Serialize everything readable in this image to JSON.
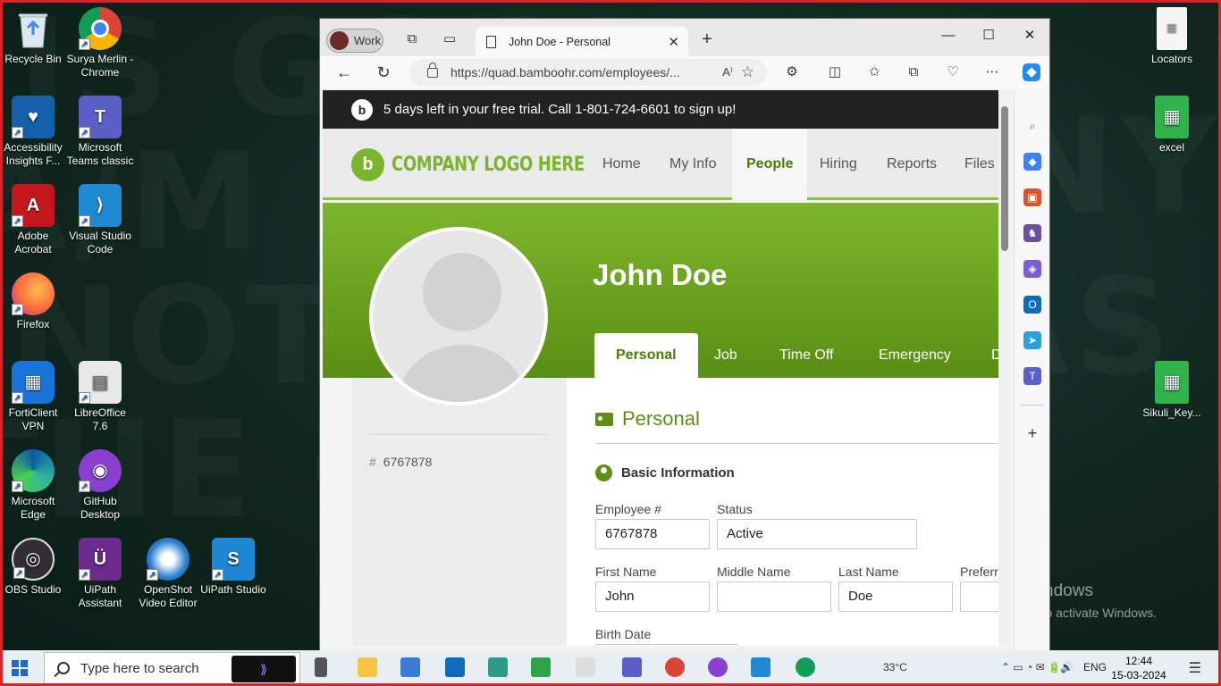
{
  "desktop": {
    "watermark_lines": [
      "IS GOOD",
      "A/M FAR",
      "NOTHIN",
      "THE GAME",
      "DISSONA",
      "ANY GO",
      "AS COME",
      "DN YOU"
    ],
    "icons_left": [
      {
        "label": "Recycle Bin",
        "icon": "recycle-bin-icon"
      },
      {
        "label": "Surya Merlin - Chrome",
        "icon": "chrome-icon"
      },
      {
        "label": "Accessibility Insights F...",
        "icon": "accessibility-insights-icon"
      },
      {
        "label": "Microsoft Teams classic",
        "icon": "teams-icon"
      },
      {
        "label": "Adobe Acrobat",
        "icon": "acrobat-icon"
      },
      {
        "label": "Visual Studio Code",
        "icon": "vscode-icon"
      },
      {
        "label": "Firefox",
        "icon": "firefox-icon"
      },
      {
        "label": "FortiClient VPN",
        "icon": "forticlient-icon"
      },
      {
        "label": "LibreOffice 7.6",
        "icon": "libreoffice-icon"
      },
      {
        "label": "Microsoft Edge",
        "icon": "edge-icon"
      },
      {
        "label": "GitHub Desktop",
        "icon": "github-desktop-icon"
      },
      {
        "label": "OBS Studio",
        "icon": "obs-icon"
      },
      {
        "label": "UiPath Assistant",
        "icon": "uipath-assistant-icon"
      },
      {
        "label": "OpenShot Video Editor",
        "icon": "openshot-icon"
      },
      {
        "label": "UiPath Studio",
        "icon": "uipath-studio-icon"
      }
    ],
    "icons_right": [
      {
        "label": "Locators",
        "icon": "text-file-icon"
      },
      {
        "label": "excel",
        "icon": "excel-file-icon"
      },
      {
        "label": "Sikuli_Key...",
        "icon": "excel-file-icon"
      }
    ],
    "activation": {
      "title": "Activate Windows",
      "subtitle": "Go to Settings to activate Windows."
    }
  },
  "browser": {
    "profile_label": "Work",
    "tab_title": "John Doe - Personal",
    "url": "https://quad.bamboohr.com/employees/...",
    "trial_banner": "5 days left in your free trial. Call 1-801-724-6601 to sign up!",
    "logo_text": "COMPANY LOGO HERE",
    "nav": [
      "Home",
      "My Info",
      "People",
      "Hiring",
      "Reports",
      "Files"
    ],
    "active_nav": "People"
  },
  "employee": {
    "name": "John Doe",
    "tabs": [
      "Personal",
      "Job",
      "Time Off",
      "Emergency",
      "D"
    ],
    "active_tab": "Personal",
    "id": "6767878",
    "section_title": "Personal",
    "subsection_title": "Basic Information",
    "fields": {
      "employee_number": {
        "label": "Employee #",
        "value": "6767878"
      },
      "status": {
        "label": "Status",
        "value": "Active"
      },
      "first_name": {
        "label": "First Name",
        "value": "John"
      },
      "middle_name": {
        "label": "Middle Name",
        "value": ""
      },
      "last_name": {
        "label": "Last Name",
        "value": "Doe"
      },
      "preferred_name": {
        "label": "Preferr",
        "value": ""
      },
      "birth_date": {
        "label": "Birth Date",
        "value": ""
      }
    }
  },
  "taskbar": {
    "search_placeholder": "Type here to search",
    "weather": "33°C",
    "language": "ENG",
    "time": "12:44",
    "date": "15-03-2024"
  },
  "colors": {
    "brand_green": "#7ab52d",
    "dark_green": "#5a8e14",
    "frame_red": "#d8232a"
  }
}
